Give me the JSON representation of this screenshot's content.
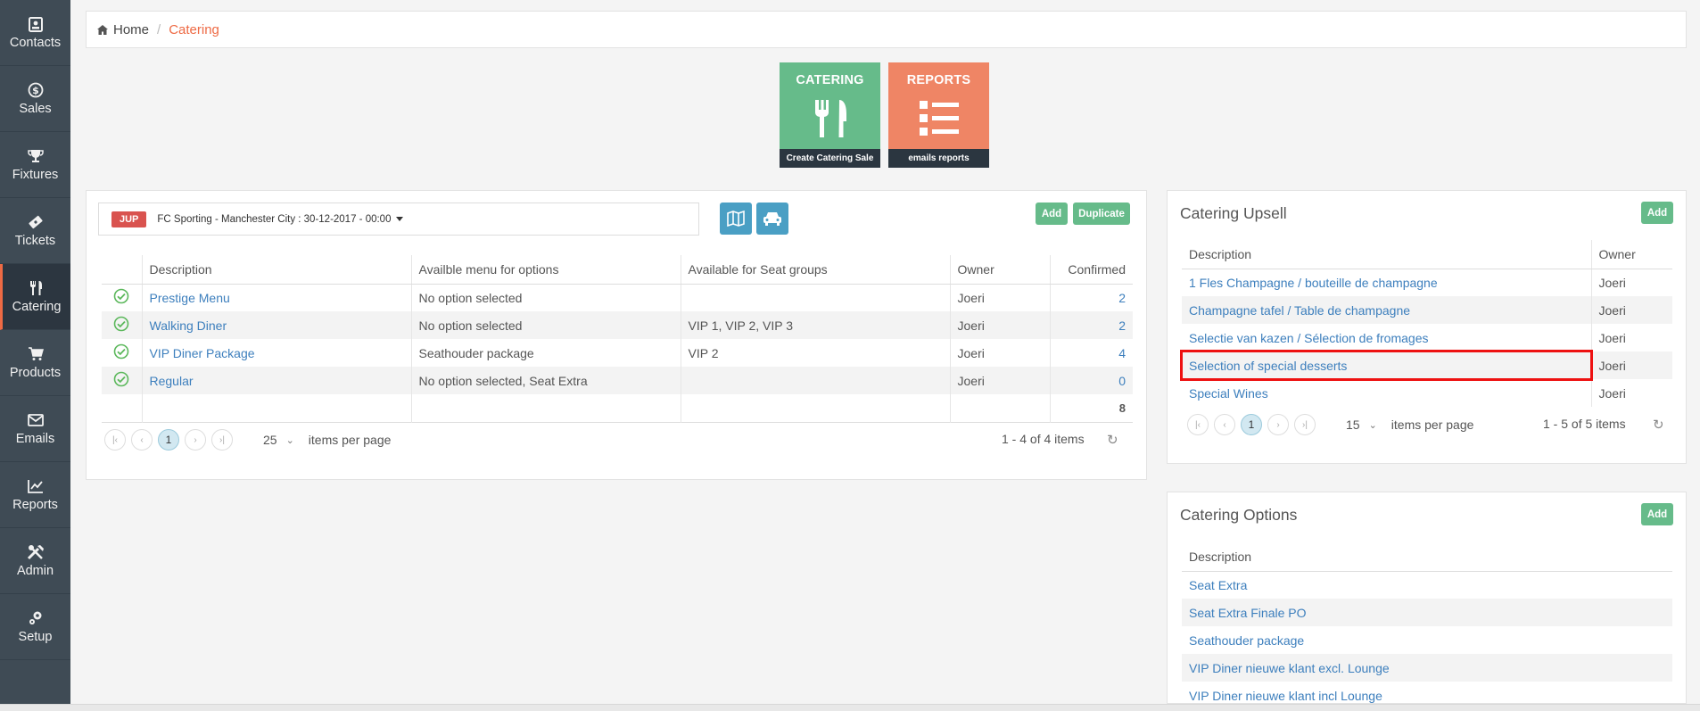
{
  "sidebar": {
    "items": [
      {
        "label": "Contacts",
        "icon": "contacts-icon"
      },
      {
        "label": "Sales",
        "icon": "dollar-icon"
      },
      {
        "label": "Fixtures",
        "icon": "trophy-icon"
      },
      {
        "label": "Tickets",
        "icon": "ticket-icon"
      },
      {
        "label": "Catering",
        "icon": "utensils-icon",
        "active": true
      },
      {
        "label": "Products",
        "icon": "cart-icon"
      },
      {
        "label": "Emails",
        "icon": "envelope-icon"
      },
      {
        "label": "Reports",
        "icon": "chart-icon"
      },
      {
        "label": "Admin",
        "icon": "tools-icon"
      },
      {
        "label": "Setup",
        "icon": "gears-icon"
      }
    ]
  },
  "breadcrumb": {
    "home": "Home",
    "current": "Catering"
  },
  "tiles": {
    "catering": {
      "title": "CATERING",
      "footer": "Create Catering Sale",
      "color": "#66bb8a"
    },
    "reports": {
      "title": "REPORTS",
      "footer": "emails reports",
      "color": "#ef8565"
    }
  },
  "main": {
    "event": {
      "badge": "JUP",
      "label": "FC Sporting - Manchester City : 30-12-2017 - 00:00"
    },
    "buttons": {
      "add": "Add",
      "duplicate": "Duplicate"
    },
    "columns": [
      "Description",
      "Availble menu for options",
      "Available for Seat groups",
      "Owner",
      "Confirmed"
    ],
    "rows": [
      {
        "description": "Prestige Menu",
        "menu": "No option selected",
        "seat_groups": "",
        "owner": "Joeri",
        "confirmed": "2"
      },
      {
        "description": "Walking Diner",
        "menu": "No option selected",
        "seat_groups": "VIP 1, VIP 2, VIP 3",
        "owner": "Joeri",
        "confirmed": "2"
      },
      {
        "description": "VIP Diner Package",
        "menu": "Seathouder package",
        "seat_groups": "VIP 2",
        "owner": "Joeri",
        "confirmed": "4"
      },
      {
        "description": "Regular",
        "menu": "No option selected, Seat Extra",
        "seat_groups": "",
        "owner": "Joeri",
        "confirmed": "0"
      }
    ],
    "total": "8",
    "pager": {
      "page": "1",
      "per_page": "25",
      "per_page_label": "items per page",
      "info": "1 - 4 of 4 items"
    }
  },
  "upsell": {
    "title": "Catering Upsell",
    "add": "Add",
    "columns": [
      "Description",
      "Owner"
    ],
    "rows": [
      {
        "description": "1 Fles Champagne / bouteille de champagne",
        "owner": "Joeri"
      },
      {
        "description": "Champagne tafel / Table de champagne",
        "owner": "Joeri"
      },
      {
        "description": "Selectie van kazen / Sélection de fromages",
        "owner": "Joeri"
      },
      {
        "description": "Selection of special desserts",
        "owner": "Joeri"
      },
      {
        "description": "Special Wines",
        "owner": "Joeri"
      }
    ],
    "pager": {
      "page": "1",
      "per_page": "15",
      "per_page_label": "items per page",
      "info": "1 - 5 of 5 items"
    }
  },
  "options": {
    "title": "Catering Options",
    "add": "Add",
    "column": "Description",
    "rows": [
      "Seat Extra",
      "Seat Extra Finale PO",
      "Seathouder package",
      "VIP Diner nieuwe klant excl. Lounge",
      "VIP Diner nieuwe klant incl Lounge"
    ]
  }
}
